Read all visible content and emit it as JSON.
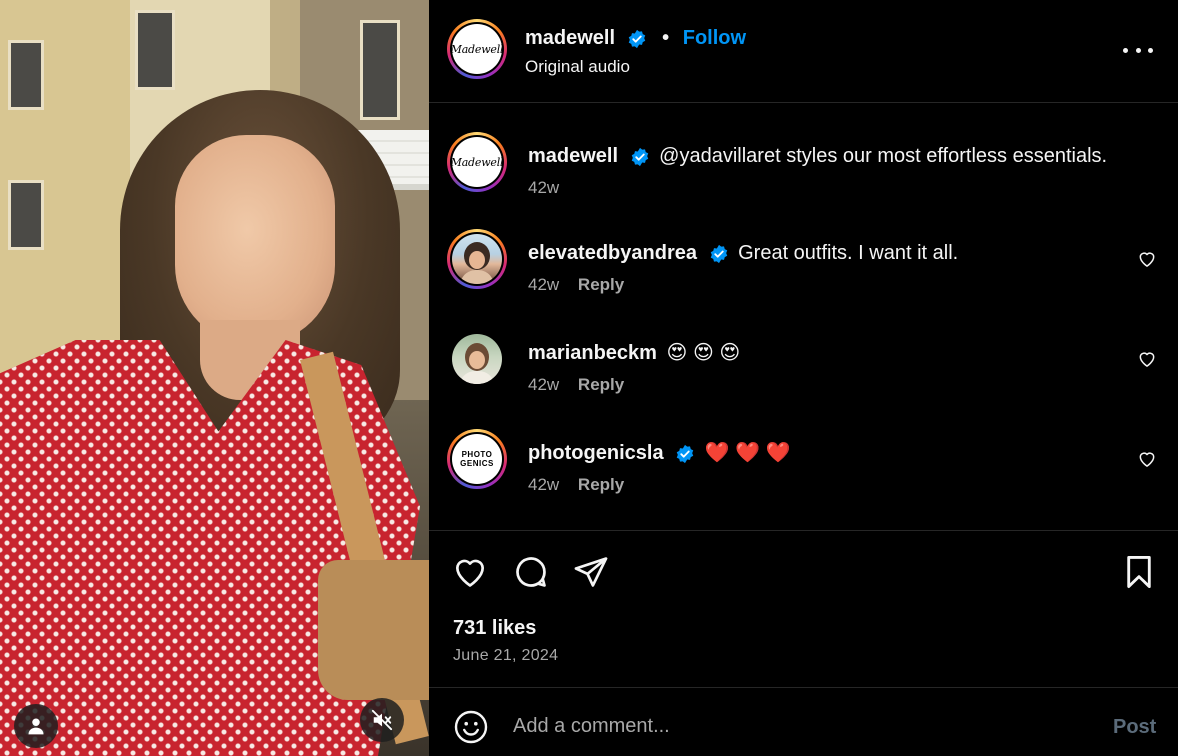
{
  "header": {
    "username": "madewell",
    "avatar_logo_text": "Madewell",
    "separator": "•",
    "follow_label": "Follow",
    "subtitle": "Original audio"
  },
  "caption": {
    "username": "madewell",
    "text": "@yadavillaret styles our most effortless essentials.",
    "time": "42w"
  },
  "comments": [
    {
      "username": "elevatedbyandrea",
      "verified": true,
      "text": "Great outfits. I want it all.",
      "time": "42w",
      "reply_label": "Reply"
    },
    {
      "username": "marianbeckm",
      "verified": false,
      "text": "😍 😍 😍",
      "time": "42w",
      "reply_label": "Reply"
    },
    {
      "username": "photogenicsla",
      "verified": true,
      "text": "❤️ ❤️ ❤️",
      "time": "42w",
      "reply_label": "Reply",
      "avatar_text_1": "PHOTO",
      "avatar_text_2": "GENICS"
    }
  ],
  "stats": {
    "likes": "731 likes",
    "date": "June 21, 2024"
  },
  "compose": {
    "placeholder": "Add a comment...",
    "post_label": "Post"
  },
  "colors": {
    "accent": "#0095f6",
    "verified": "#0095f6",
    "background": "#000000",
    "secondary_text": "#a8a8a8"
  },
  "icons": [
    "user-icon",
    "mute-icon",
    "more-icon",
    "heart-icon",
    "comment-icon",
    "share-icon",
    "bookmark-icon",
    "emoji-icon",
    "verified-icon"
  ]
}
